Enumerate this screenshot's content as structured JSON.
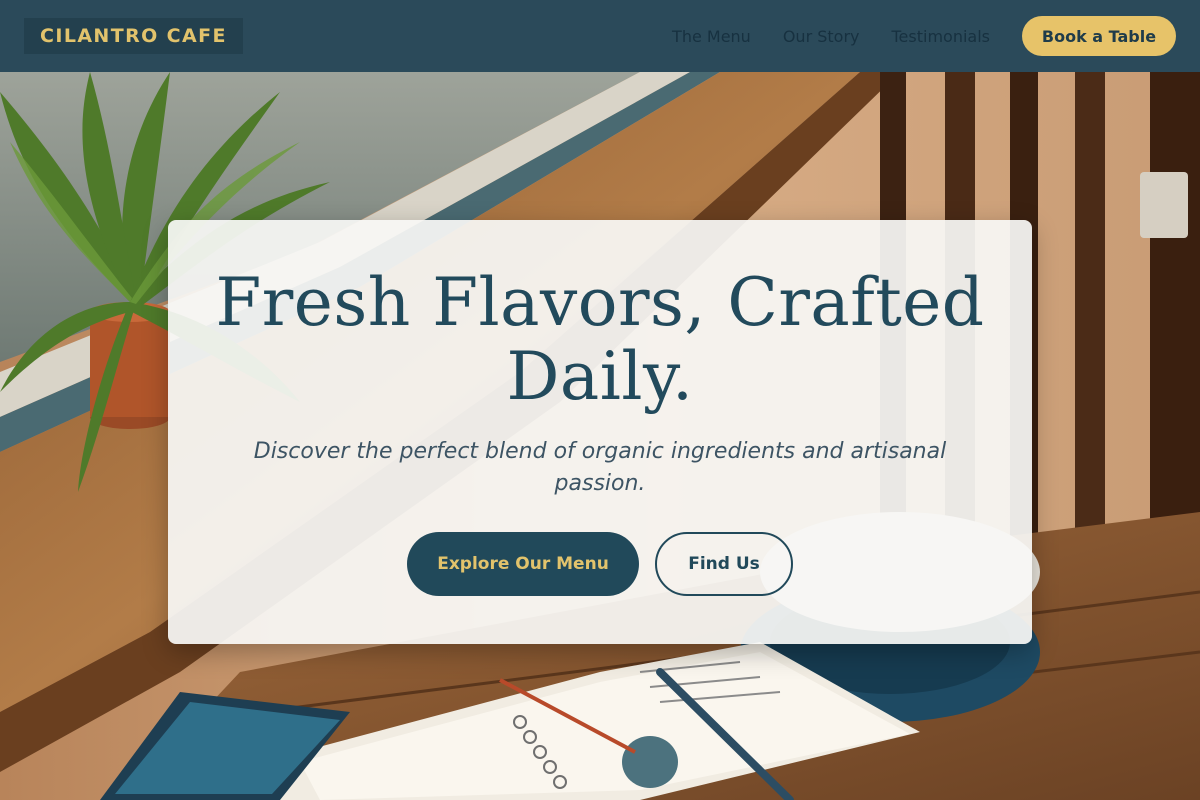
{
  "brand": {
    "name": "CILANTRO CAFE"
  },
  "nav": {
    "links": [
      {
        "label": "The Menu"
      },
      {
        "label": "Our Story"
      },
      {
        "label": "Testimonials"
      }
    ],
    "cta_label": "Book a Table"
  },
  "hero": {
    "title": "Fresh Flavors, Crafted Daily.",
    "subtitle": "Discover the perfect blend of organic ingredients and artisanal passion.",
    "primary_button": "Explore Our Menu",
    "secondary_button": "Find Us",
    "background_image": "cafe-table-with-plant-coffee-and-notebook"
  },
  "colors": {
    "nav_bg": "#2b4a5a",
    "brand_gold": "#e2c36c",
    "cta_gold": "#e7c369",
    "primary_teal": "#21495a",
    "card_bg": "#f7f7f5"
  }
}
